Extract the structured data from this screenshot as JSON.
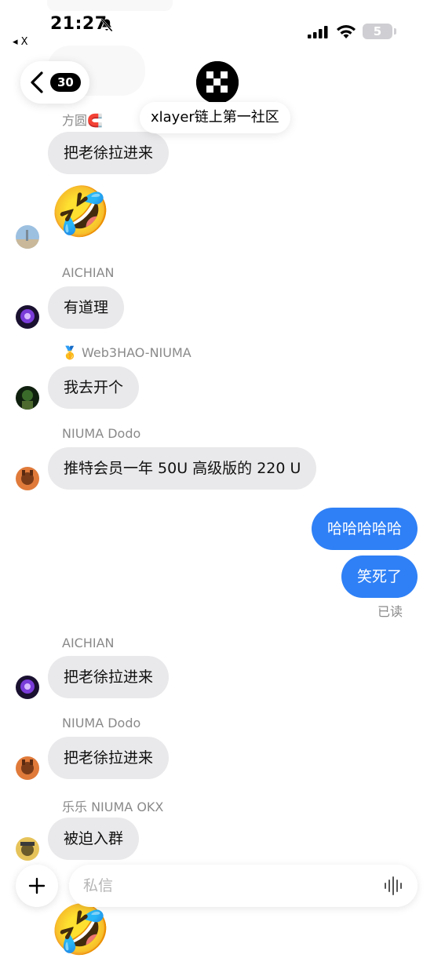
{
  "status_bar": {
    "time": "21:27",
    "back_app": "◂ X",
    "battery": "5",
    "icons": [
      "bell-slash-icon",
      "signal-icon",
      "wifi-icon",
      "battery-icon"
    ]
  },
  "header": {
    "unread_count": "30",
    "group_name": "xlayer链上第一社区",
    "icons": [
      "chevron-left-icon",
      "okx-logo-icon"
    ]
  },
  "messages": [
    {
      "sender": "方圆🧲",
      "text": "把老徐拉进来"
    },
    {
      "sender": "",
      "text": "🤣"
    },
    {
      "sender": "AICHIAN",
      "text": "有道理"
    },
    {
      "sender": "🥇 Web3HAO-NIUMA",
      "text": "我去开个"
    },
    {
      "sender": "NIUMA Dodo",
      "text": "推特会员一年 50U  高级版的 220 U"
    },
    {
      "sender": "",
      "text": "哈哈哈哈哈"
    },
    {
      "sender": "",
      "text": "笑死了"
    },
    {
      "sender": "AICHIAN",
      "text": "把老徐拉进来"
    },
    {
      "sender": "NIUMA Dodo",
      "text": "把老徐拉进来"
    },
    {
      "sender": "乐乐 NIUMA OKX",
      "text": "被迫入群"
    },
    {
      "sender": "",
      "text": "🤣"
    }
  ],
  "read_status": "已读",
  "input": {
    "placeholder": "私信",
    "icons": [
      "plus-icon",
      "voice-wave-icon"
    ]
  },
  "colors": {
    "outgoing_bubble": "#2f80f6",
    "incoming_bubble": "#e9e9eb",
    "sender_name": "#8a8a8a"
  }
}
